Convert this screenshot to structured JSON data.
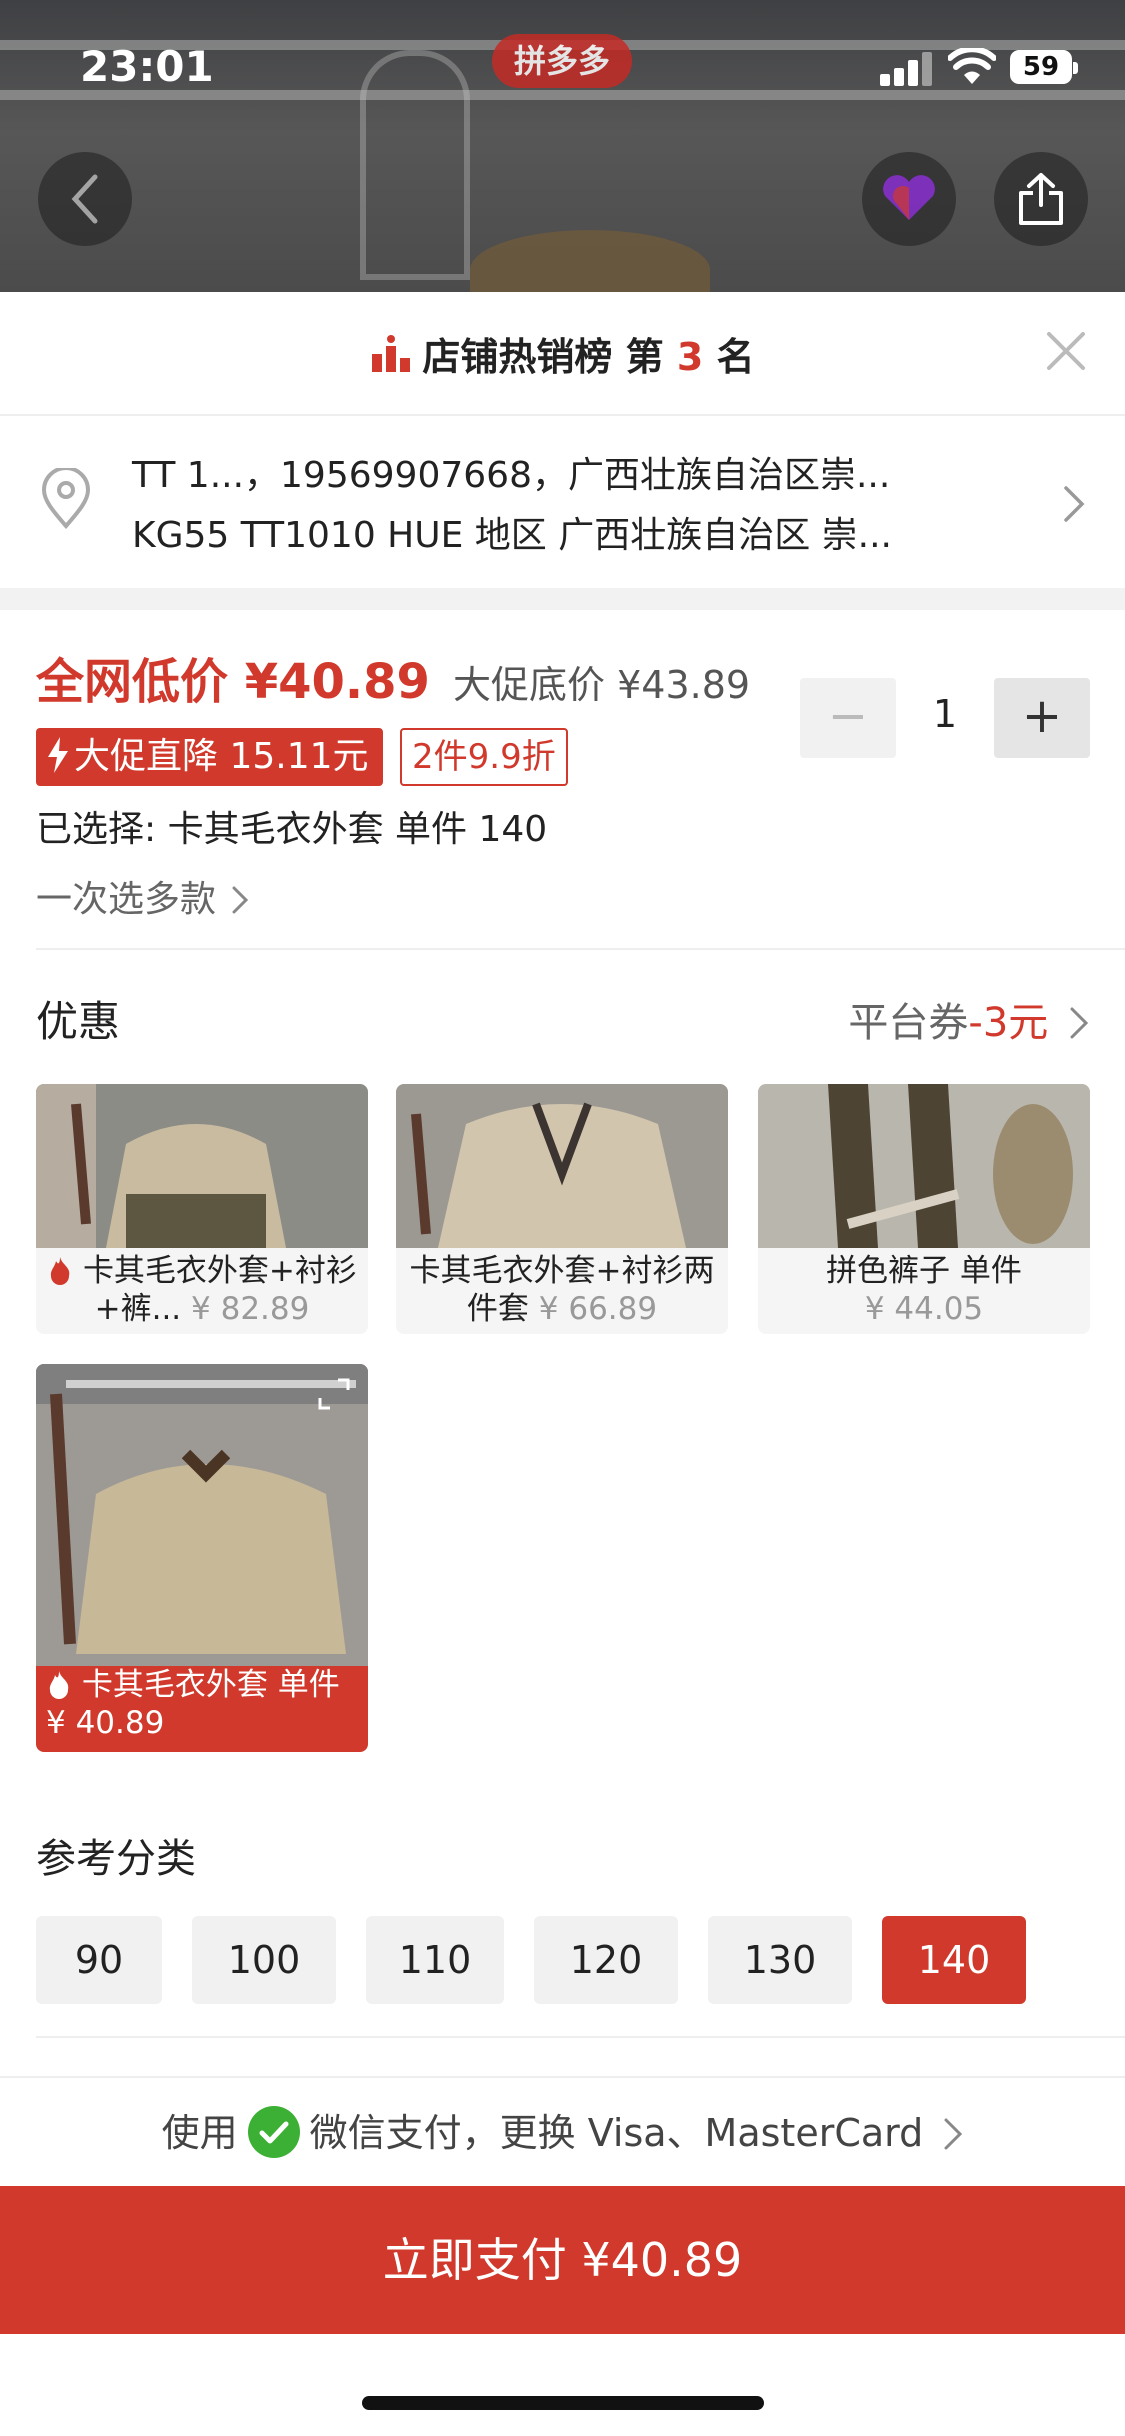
{
  "status_bar": {
    "time": "23:01",
    "battery": "59",
    "app_badge": "拼多多"
  },
  "rank": {
    "prefix": "店铺热销榜 第",
    "number": "3",
    "suffix": "名"
  },
  "address": {
    "line1": "TT 1...，19569907668，广西壮族自治区崇...",
    "line2": "KG55 TT1010 HUE 地区 广西壮族自治区 崇..."
  },
  "price": {
    "main_label": "全网低价 ¥40.89",
    "promo_label": "大促底价 ¥43.89",
    "tag_discount": "大促直降 15.11元",
    "tag_bundle": "2件9.9折",
    "selected": "已选择: 卡其毛衣外套   单件 140",
    "multi_select": "一次选多款"
  },
  "stepper": {
    "minus": "−",
    "value": "1",
    "plus": "+"
  },
  "offers": {
    "title": "优惠",
    "coupon_prefix": "平台券",
    "coupon_value": "-3元"
  },
  "products": [
    {
      "name": "卡其毛衣外套+衬衫+裤...",
      "price": "¥ 82.89",
      "hot": true
    },
    {
      "name": "卡其毛衣外套+衬衫两件套",
      "price": "¥ 66.89",
      "hot": false
    },
    {
      "name": "拼色裤子  单件",
      "price": "¥ 44.05",
      "hot": false
    },
    {
      "name": "卡其毛衣外套  单件",
      "price": "¥ 40.89",
      "hot": true,
      "selected": true
    }
  ],
  "category": {
    "title": "参考分类",
    "sizes": [
      "90",
      "100",
      "110",
      "120",
      "130",
      "140"
    ],
    "selected": "140"
  },
  "payment": {
    "prefix": "使用",
    "method": "微信支付，更换 Visa、MasterCard",
    "button": "立即支付 ¥40.89"
  },
  "colors": {
    "accent": "#d0392b",
    "wechat": "#3cb034"
  }
}
